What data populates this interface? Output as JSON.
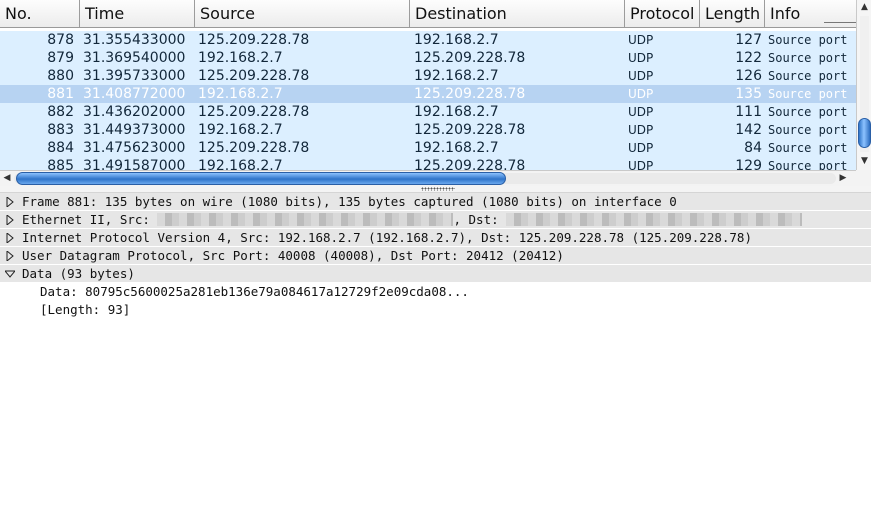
{
  "packet_list": {
    "columns": [
      "No.",
      "Time",
      "Source",
      "Destination",
      "Protocol",
      "Length",
      "Info"
    ],
    "rows": [
      {
        "no": "878",
        "time": "31.355433000",
        "source": "125.209.228.78",
        "destination": "192.168.2.7",
        "protocol": "UDP",
        "length": "127",
        "info": "Source port"
      },
      {
        "no": "879",
        "time": "31.369540000",
        "source": "192.168.2.7",
        "destination": "125.209.228.78",
        "protocol": "UDP",
        "length": "122",
        "info": "Source port"
      },
      {
        "no": "880",
        "time": "31.395733000",
        "source": "125.209.228.78",
        "destination": "192.168.2.7",
        "protocol": "UDP",
        "length": "126",
        "info": "Source port"
      },
      {
        "no": "881",
        "time": "31.408772000",
        "source": "192.168.2.7",
        "destination": "125.209.228.78",
        "protocol": "UDP",
        "length": "135",
        "info": "Source port"
      },
      {
        "no": "882",
        "time": "31.436202000",
        "source": "125.209.228.78",
        "destination": "192.168.2.7",
        "protocol": "UDP",
        "length": "111",
        "info": "Source port"
      },
      {
        "no": "883",
        "time": "31.449373000",
        "source": "192.168.2.7",
        "destination": "125.209.228.78",
        "protocol": "UDP",
        "length": "142",
        "info": "Source port"
      },
      {
        "no": "884",
        "time": "31.475623000",
        "source": "125.209.228.78",
        "destination": "192.168.2.7",
        "protocol": "UDP",
        "length": "84",
        "info": "Source port"
      },
      {
        "no": "885",
        "time": "31.491587000",
        "source": "192.168.2.7",
        "destination": "125.209.228.78",
        "protocol": "UDP",
        "length": "129",
        "info": "Source port"
      }
    ],
    "selected_no": "881"
  },
  "details": {
    "frame": "Frame 881: 135 bytes on wire (1080 bits), 135 bytes captured (1080 bits) on interface 0",
    "ethernet_prefix": "Ethernet II, Src:",
    "ethernet_mid": ", Dst:",
    "ip": "Internet Protocol Version 4, Src: 192.168.2.7 (192.168.2.7), Dst: 125.209.228.78 (125.209.228.78)",
    "udp": "User Datagram Protocol, Src Port: 40008 (40008), Dst Port: 20412 (20412)",
    "data": "Data (93 bytes)",
    "data_value": "Data: 80795c5600025a281eb136e79a084617a12729f2e09cda08...",
    "data_length": "[Length: 93]"
  },
  "colors": {
    "row_bg": "#dcefff",
    "row_selected_bg": "#b7d3f2",
    "tree_row_bg": "#e6e6e6",
    "scroll_thumb": "#2f74c9"
  },
  "icons": {
    "expander_collapsed": "triangle-right-icon",
    "expander_expanded": "triangle-down-icon",
    "scroll_up": "arrow-up-icon",
    "scroll_down": "arrow-down-icon",
    "scroll_left": "arrow-left-icon",
    "scroll_right": "arrow-right-icon"
  }
}
